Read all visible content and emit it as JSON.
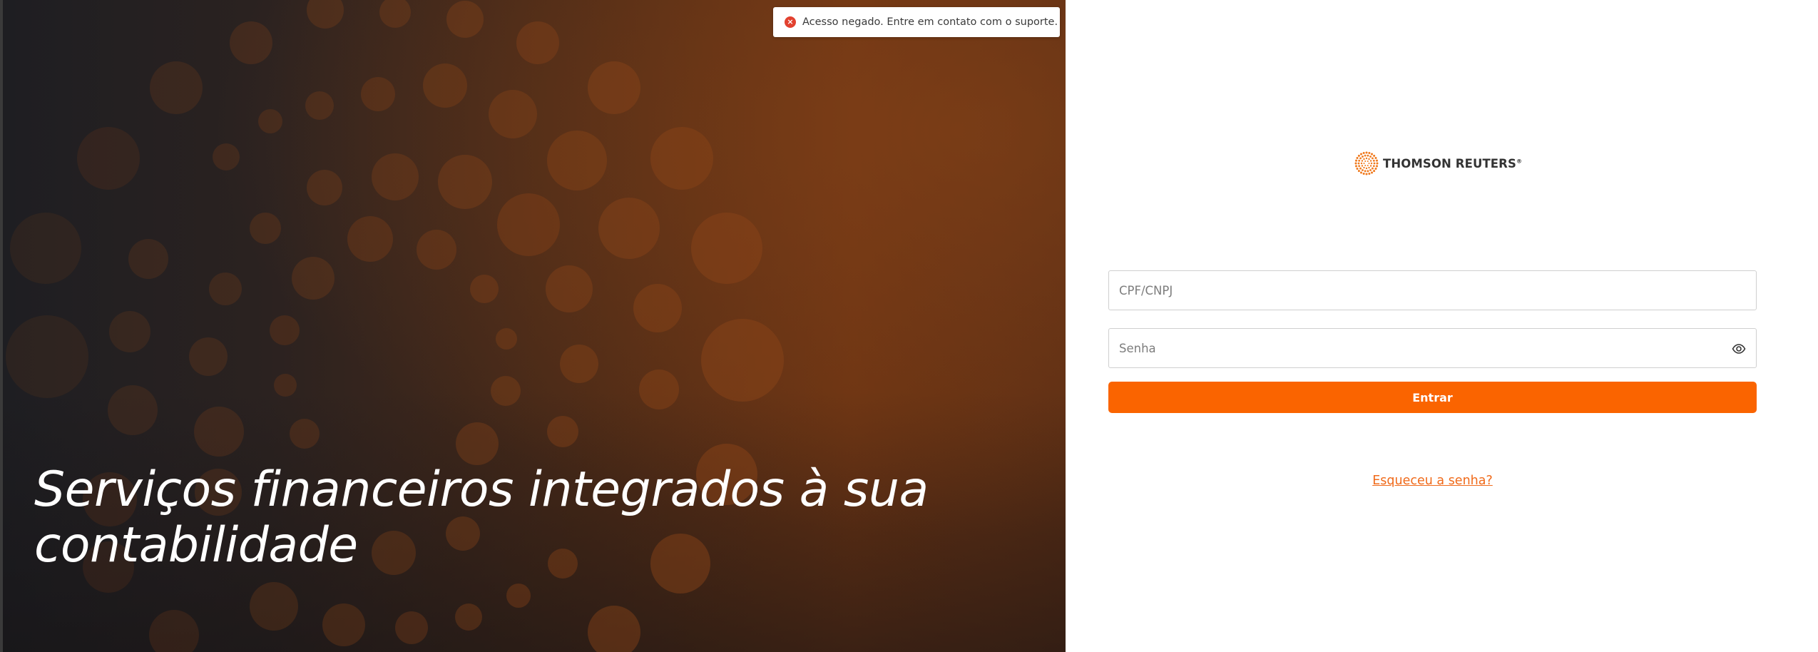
{
  "hero": {
    "title_line1": "Serviços financeiros integrados à sua",
    "title_line2": "contabilidade",
    "background_colors": [
      "#1e1e22",
      "#4b2a17",
      "#6a3313"
    ],
    "dot_color": "#8a4418"
  },
  "toast": {
    "icon": "error-icon",
    "icon_glyph": "×",
    "message": "Acesso negado. Entre em contato com o suporte.",
    "color": "#e2412f"
  },
  "logo": {
    "text": "THOMSON REUTERS",
    "registered": "®",
    "icon": "thomson-reuters-logo-icon"
  },
  "form": {
    "cpf_placeholder": "CPF/CNPJ",
    "cpf_value": "",
    "password_placeholder": "Senha",
    "password_value": "",
    "password_toggle_icon": "eye-icon",
    "submit_label": "Entrar",
    "forgot_label": "Esqueceu a senha?",
    "accent_color": "#fa6400"
  }
}
